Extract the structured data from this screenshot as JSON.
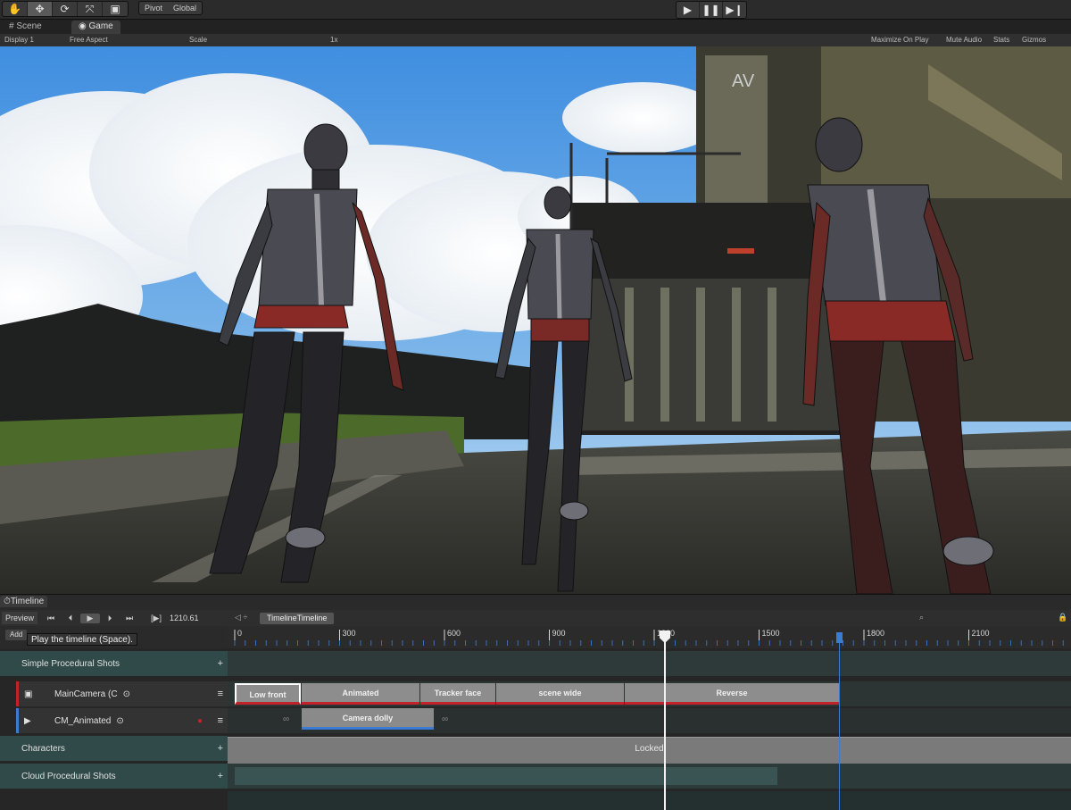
{
  "toolbar": {
    "tools": [
      "hand-icon",
      "move-icon",
      "rotate-icon",
      "scale-icon",
      "rect-icon"
    ],
    "pivot_label": "Pivot",
    "global_label": "Global",
    "play_buttons": [
      "play-icon",
      "pause-icon",
      "step-icon"
    ]
  },
  "tabs": {
    "scene_label": "Scene",
    "game_label": "Game"
  },
  "gamebar": {
    "display": "Display 1",
    "aspect": "Free Aspect",
    "scale_label": "Scale",
    "scale_value": "1x",
    "maximize": "Maximize On Play",
    "mute": "Mute Audio",
    "stats": "Stats",
    "gizmos": "Gizmos"
  },
  "timeline": {
    "window_title": "Timeline",
    "preview_label": "Preview",
    "current_time": "1210.61",
    "asset_name": "TimelineTimeline",
    "add_label": "Add",
    "tooltip": "Play the timeline (Space).",
    "ruler_ticks": [
      "0",
      "300",
      "600",
      "900",
      "1200",
      "1500",
      "1800",
      "2100"
    ],
    "tracks": {
      "group1": "Simple Procedural Shots",
      "main_camera": "MainCamera (C",
      "cm_animated": "CM_Animated",
      "characters": "Characters",
      "cloud": "Cloud Procedural Shots"
    },
    "camera_clips": [
      "Low front",
      "Animated",
      "Tracker face",
      "scene wide",
      "Reverse"
    ],
    "dolly_clip": "Camera dolly",
    "locked_label": "Locked",
    "colors": {
      "group_bg": "#2f4a49",
      "clip_underline": "#c2222a",
      "end_marker": "#3c7bd3"
    }
  }
}
